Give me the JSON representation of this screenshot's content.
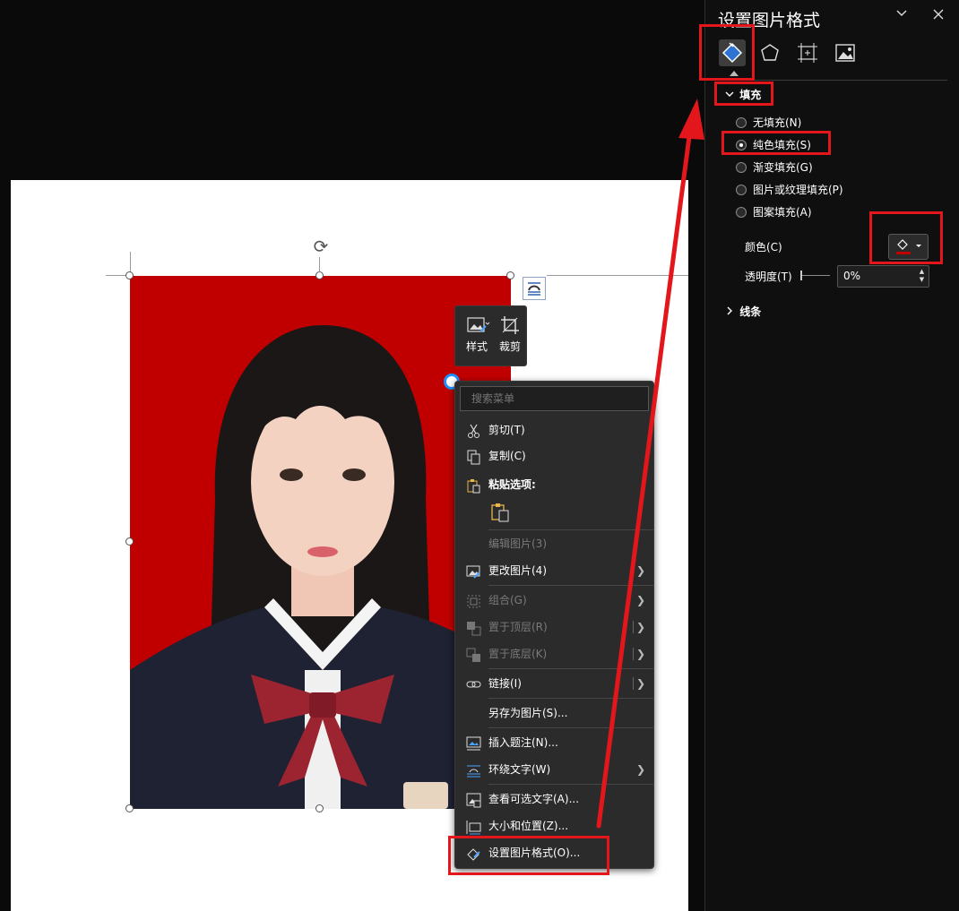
{
  "pane": {
    "title": "设置图片格式",
    "fill_section": "填充",
    "line_section": "线条",
    "fill_options": [
      {
        "label": "无填充(N)",
        "selected": false
      },
      {
        "label": "纯色填充(S)",
        "selected": true
      },
      {
        "label": "渐变填充(G)",
        "selected": false
      },
      {
        "label": "图片或纹理填充(P)",
        "selected": false
      },
      {
        "label": "图案填充(A)",
        "selected": false
      }
    ],
    "color_label": "颜色(C)",
    "transparency_label": "透明度(T)",
    "transparency_value": "0%",
    "fill_color": "#c00000"
  },
  "mini_toolbar": {
    "style_label": "样式",
    "crop_label": "裁剪"
  },
  "context_menu": {
    "search_placeholder": "搜索菜单",
    "items": [
      {
        "label": "剪切(T)",
        "icon": "scissors-icon",
        "enabled": true
      },
      {
        "label": "复制(C)",
        "icon": "copy-icon",
        "enabled": true
      },
      {
        "label": "粘贴选项:",
        "icon": "paste-icon",
        "enabled": true
      },
      {
        "label": "编辑图片(3)",
        "enabled": false
      },
      {
        "label": "更改图片(4)",
        "icon": "change-picture-icon",
        "enabled": true,
        "submenu": true
      },
      {
        "label": "组合(G)",
        "icon": "group-icon",
        "enabled": false,
        "submenu": true
      },
      {
        "label": "置于顶层(R)",
        "icon": "bring-front-icon",
        "enabled": false,
        "submenu": true
      },
      {
        "label": "置于底层(K)",
        "icon": "send-back-icon",
        "enabled": false,
        "submenu": true
      },
      {
        "label": "链接(I)",
        "icon": "link-icon",
        "enabled": true,
        "submenu": true
      },
      {
        "label": "另存为图片(S)...",
        "enabled": true
      },
      {
        "label": "插入题注(N)...",
        "icon": "caption-icon",
        "enabled": true
      },
      {
        "label": "环绕文字(W)",
        "icon": "wrap-text-icon",
        "enabled": true,
        "submenu": true
      },
      {
        "label": "查看可选文字(A)...",
        "icon": "alt-text-icon",
        "enabled": true
      },
      {
        "label": "大小和位置(Z)...",
        "icon": "size-position-icon",
        "enabled": true
      },
      {
        "label": "设置图片格式(O)...",
        "icon": "format-picture-icon",
        "enabled": true
      }
    ]
  },
  "colors": {
    "accent_red": "#e3161b",
    "photo_background": "#c00000"
  }
}
